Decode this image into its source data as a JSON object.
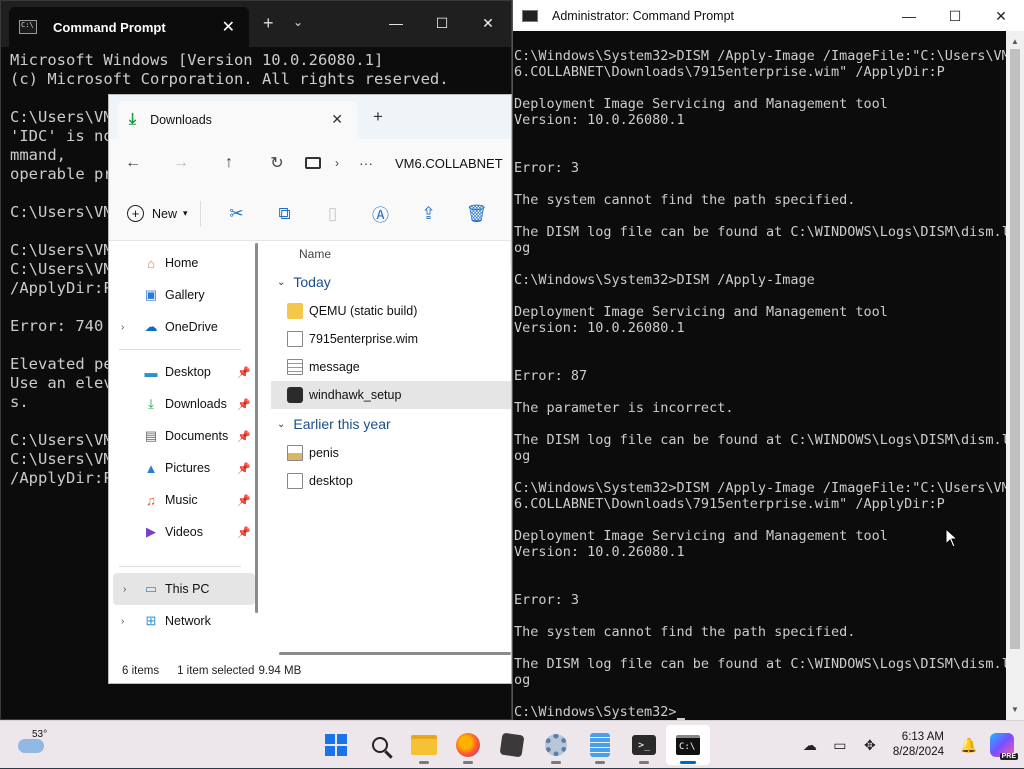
{
  "cmd_left": {
    "tab_title": "Command Prompt",
    "new_tab": "+",
    "tab_dropdown": "⌄",
    "lines": [
      "Microsoft Windows [Version 10.0.26080.1]",
      "(c) Microsoft Corporation. All rights reserved.",
      "",
      "C:\\Users\\VM",
      "'IDC' is no",
      "mmand,",
      "operable pr",
      "",
      "C:\\Users\\VM",
      "",
      "C:\\Users\\VM",
      "C:\\Users\\VM",
      "/ApplyDir:P",
      "",
      "Error: 740",
      "",
      "Elevated pe",
      "Use an elev",
      "s.",
      "",
      "C:\\Users\\VM",
      "C:\\Users\\VM",
      "/ApplyDir:P"
    ]
  },
  "cmd_right": {
    "title": "Administrator: Command Prompt",
    "lines": [
      "C:\\Windows\\System32>DISM /Apply-Image /ImageFile:\"C:\\Users\\VM",
      "6.COLLABNET\\Downloads\\7915enterprise.wim\" /ApplyDir:P",
      "",
      "Deployment Image Servicing and Management tool",
      "Version: 10.0.26080.1",
      "",
      "",
      "Error: 3",
      "",
      "The system cannot find the path specified.",
      "",
      "The DISM log file can be found at C:\\WINDOWS\\Logs\\DISM\\dism.l",
      "og",
      "",
      "C:\\Windows\\System32>DISM /Apply-Image",
      "",
      "Deployment Image Servicing and Management tool",
      "Version: 10.0.26080.1",
      "",
      "",
      "Error: 87",
      "",
      "The parameter is incorrect.",
      "",
      "The DISM log file can be found at C:\\WINDOWS\\Logs\\DISM\\dism.l",
      "og",
      "",
      "C:\\Windows\\System32>DISM /Apply-Image /ImageFile:\"C:\\Users\\VM",
      "6.COLLABNET\\Downloads\\7915enterprise.wim\" /ApplyDir:P",
      "",
      "Deployment Image Servicing and Management tool",
      "Version: 10.0.26080.1",
      "",
      "",
      "Error: 3",
      "",
      "The system cannot find the path specified.",
      "",
      "The DISM log file can be found at C:\\WINDOWS\\Logs\\DISM\\dism.l",
      "og",
      ""
    ],
    "prompt": "C:\\Windows\\System32>"
  },
  "window_controls": {
    "minimize": "—",
    "maximize": "☐",
    "close": "✕"
  },
  "explorer": {
    "tab_title": "Downloads",
    "new_tab": "+",
    "breadcrumb": "VM6.COLLABNET",
    "breadcrumb_more": "···",
    "new_label": "New",
    "column_name": "Name",
    "sidebar": [
      {
        "label": "Home",
        "icon": "home-icon",
        "pinned": false
      },
      {
        "label": "Gallery",
        "icon": "gallery-icon",
        "pinned": false
      },
      {
        "label": "OneDrive",
        "icon": "onedrive-icon",
        "pinned": false,
        "expandable": true
      }
    ],
    "quick_access": [
      {
        "label": "Desktop",
        "icon": "desktop-icon"
      },
      {
        "label": "Downloads",
        "icon": "downloads-icon"
      },
      {
        "label": "Documents",
        "icon": "documents-icon"
      },
      {
        "label": "Pictures",
        "icon": "pictures-icon"
      },
      {
        "label": "Music",
        "icon": "music-icon"
      },
      {
        "label": "Videos",
        "icon": "videos-icon"
      }
    ],
    "drives": [
      {
        "label": "This PC",
        "icon": "this-pc-icon",
        "selected": true
      },
      {
        "label": "Network",
        "icon": "network-icon",
        "selected": false
      }
    ],
    "groups": [
      {
        "label": "Today",
        "files": [
          {
            "name": "QEMU (static build)",
            "type": "folder"
          },
          {
            "name": "7915enterprise.wim",
            "type": "file"
          },
          {
            "name": "message",
            "type": "doc"
          },
          {
            "name": "windhawk_setup",
            "type": "app",
            "selected": true
          }
        ]
      },
      {
        "label": "Earlier this year",
        "files": [
          {
            "name": "penis",
            "type": "img"
          },
          {
            "name": "desktop",
            "type": "file"
          }
        ]
      }
    ],
    "status": {
      "items": "6 items",
      "selected": "1 item selected",
      "size": "9.94 MB"
    }
  },
  "taskbar": {
    "temperature": "53°",
    "apps": [
      {
        "name": "start",
        "active": false,
        "running": false
      },
      {
        "name": "search",
        "active": false,
        "running": false
      },
      {
        "name": "file-explorer",
        "active": false,
        "running": true
      },
      {
        "name": "firefox",
        "active": false,
        "running": true
      },
      {
        "name": "windhawk",
        "active": false,
        "running": false
      },
      {
        "name": "settings",
        "active": false,
        "running": true
      },
      {
        "name": "notepad",
        "active": false,
        "running": true
      },
      {
        "name": "terminal",
        "active": false,
        "running": true
      },
      {
        "name": "command-prompt",
        "active": true,
        "running": true
      }
    ],
    "time": "6:13 AM",
    "date": "8/28/2024",
    "copilot_badge": "PRE"
  }
}
